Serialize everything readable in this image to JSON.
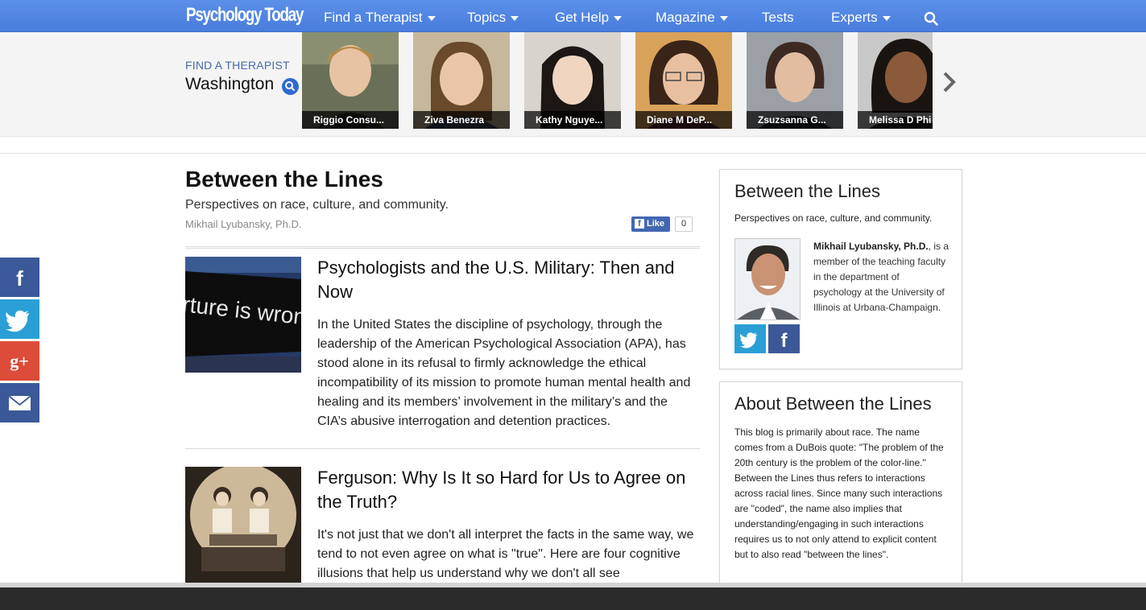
{
  "nav": {
    "logo": "Psychology Today",
    "items": [
      {
        "label": "Find a Therapist",
        "dropdown": true
      },
      {
        "label": "Topics",
        "dropdown": true
      },
      {
        "label": "Get Help",
        "dropdown": true
      },
      {
        "label": "Magazine",
        "dropdown": true
      },
      {
        "label": "Tests",
        "dropdown": false
      },
      {
        "label": "Experts",
        "dropdown": true
      }
    ],
    "search_icon": "search-icon"
  },
  "therapist_strip": {
    "label": "FIND A THERAPIST",
    "city": "Washington",
    "therapists": [
      {
        "name": "Riggio Consu..."
      },
      {
        "name": "Ziva Benezra"
      },
      {
        "name": "Kathy Nguye..."
      },
      {
        "name": "Diane M DeP..."
      },
      {
        "name": "Zsuzsanna G..."
      },
      {
        "name": "Melissa D Phi"
      }
    ],
    "next_icon": "chevron-right-icon"
  },
  "blog": {
    "title": "Between the Lines",
    "tagline": "Perspectives on race, culture, and community.",
    "author": "Mikhail Lyubansky, Ph.D.",
    "fb_like_label": "Like",
    "fb_like_count": "0"
  },
  "articles": [
    {
      "title": "Psychologists and the U.S. Military: Then and Now",
      "image_text": "rture is wrong.",
      "body": "In the United States the discipline of psychology, through the leadership of the American Psychological Association (APA), has stood alone in its refusal to firmly acknowledge the ethical incompatibility of its mission to promote human mental health and healing and its members’ involvement in the military’s and the CIA’s abusive interrogation and detention practices."
    },
    {
      "title": "Ferguson: Why Is It so Hard for Us to Agree on the Truth?",
      "body": "It's not just that we don't all interpret the facts in the same way, we tend to not even agree on what is \"true\". Here are four cognitive illusions that help us understand why we don't all see"
    }
  ],
  "social": [
    "facebook-icon",
    "twitter-icon",
    "google-plus-icon",
    "email-icon"
  ],
  "sidebar": {
    "box1": {
      "title": "Between the Lines",
      "tagline": "Perspectives on race, culture, and community.",
      "author_name": "Mikhail Lyubansky, Ph.D.",
      "author_bio": ", is a member of the teaching faculty in the department of psychology at the University of Illinois at Urbana-Champaign."
    },
    "box2": {
      "title": "About Between the Lines",
      "text": "This blog is primarily about race.  The name comes from a DuBois quote: \"The problem of the 20th century is the problem of the color-line.\" Between the Lines thus refers to interactions across racial lines. Since many such interactions are \"coded\", the name also implies that understanding/engaging in such interactions requires us to not only attend to explicit content but to also read \"between the lines\"."
    }
  },
  "colors": {
    "nav_blue": "#4a7ddc",
    "facebook": "#3b5998",
    "twitter": "#2a9fd6",
    "google_plus": "#dd4b39",
    "email": "#3b5998"
  }
}
